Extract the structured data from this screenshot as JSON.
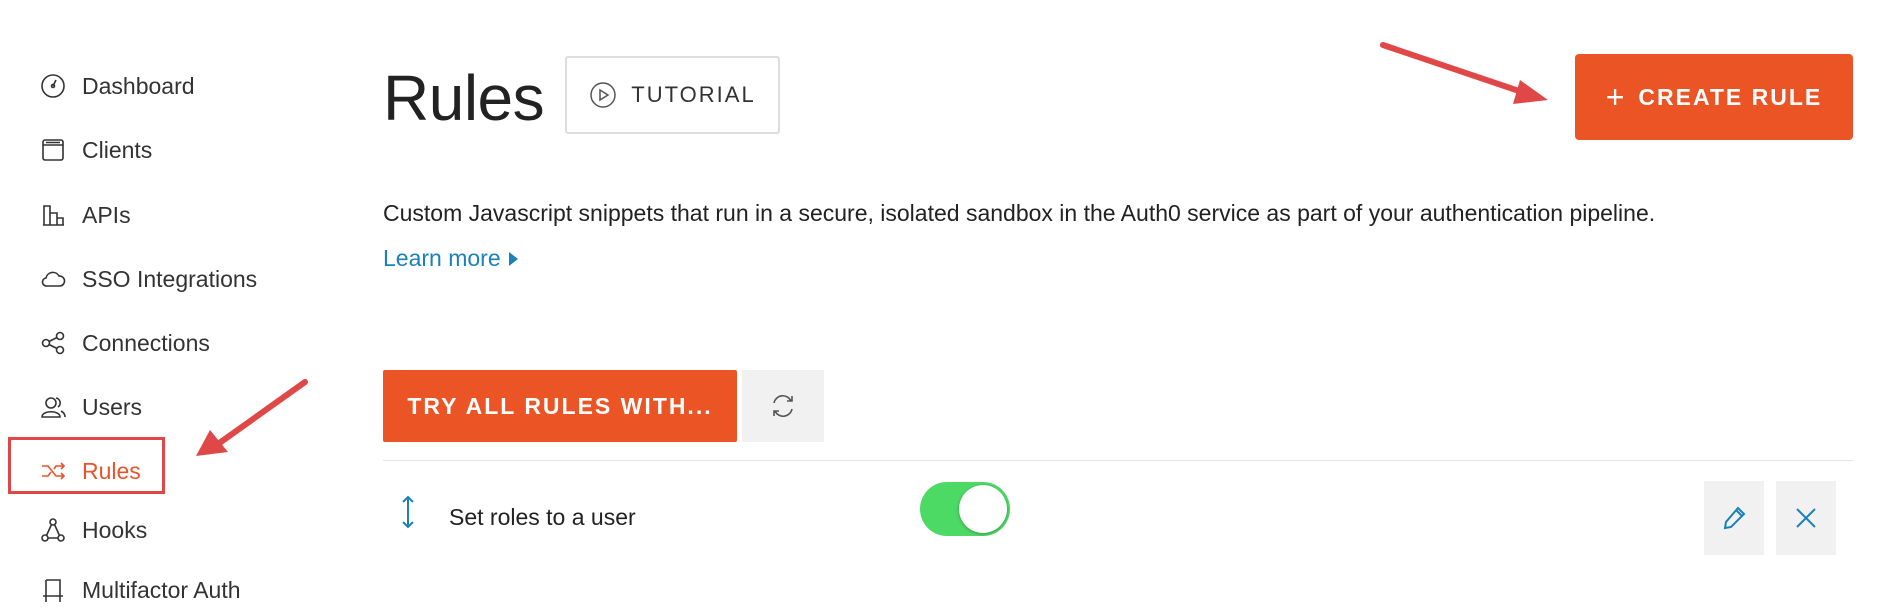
{
  "sidebar": {
    "items": [
      {
        "label": "Dashboard",
        "icon": "gauge-icon"
      },
      {
        "label": "Clients",
        "icon": "window-icon"
      },
      {
        "label": "APIs",
        "icon": "building-icon"
      },
      {
        "label": "SSO Integrations",
        "icon": "cloud-icon"
      },
      {
        "label": "Connections",
        "icon": "share-nodes-icon"
      },
      {
        "label": "Users",
        "icon": "users-icon"
      },
      {
        "label": "Rules",
        "icon": "shuffle-icon"
      },
      {
        "label": "Hooks",
        "icon": "hook-nodes-icon"
      },
      {
        "label": "Multifactor Auth",
        "icon": "bookmark-icon"
      }
    ],
    "active": "Rules"
  },
  "header": {
    "title": "Rules",
    "tutorial_label": "TUTORIAL",
    "create_label": "CREATE RULE",
    "create_plus": "+"
  },
  "intro": {
    "description": "Custom Javascript snippets that run in a secure, isolated sandbox in the Auth0 service as part of your authentication pipeline.",
    "learn_more": "Learn more"
  },
  "actions": {
    "try_label": "TRY ALL RULES WITH..."
  },
  "rules": [
    {
      "name": "Set roles to a user",
      "enabled": true
    }
  ],
  "colors": {
    "accent": "#eb5424",
    "link": "#1b81b7",
    "toggle_on": "#4cd964",
    "annotation": "#e04848"
  }
}
